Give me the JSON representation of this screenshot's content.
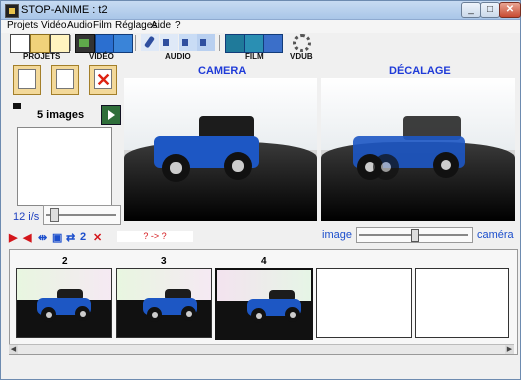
{
  "window": {
    "title": "STOP-ANIME : t2",
    "min": "_",
    "max": "□",
    "close": "✕"
  },
  "menu": [
    "Projets",
    "Vidéo",
    "Audio",
    "Film",
    "Réglages",
    "Aide",
    "?"
  ],
  "toolbar": {
    "projets_label": "PROJETS",
    "video_label": "VIDÉO",
    "audio_label": "AUDIO",
    "film_label": "FILM",
    "vdub_label": "VDUB"
  },
  "left": {
    "images_count": "5 images",
    "fps": "12 i/s"
  },
  "panels": {
    "camera_title": "CAMERA",
    "offset_title": "DÉCALAGE"
  },
  "offset": {
    "image_label": "image",
    "camera_label": "caméra",
    "level": 0.5
  },
  "controls": {
    "counter": "2",
    "status": "? -> ?"
  },
  "frames": [
    {
      "label": "2"
    },
    {
      "label": "3"
    },
    {
      "label": "4"
    }
  ],
  "colors": {
    "accent_blue": "#1f3bd8",
    "control_red": "#d4161b",
    "car_blue": "#1d57c4"
  }
}
